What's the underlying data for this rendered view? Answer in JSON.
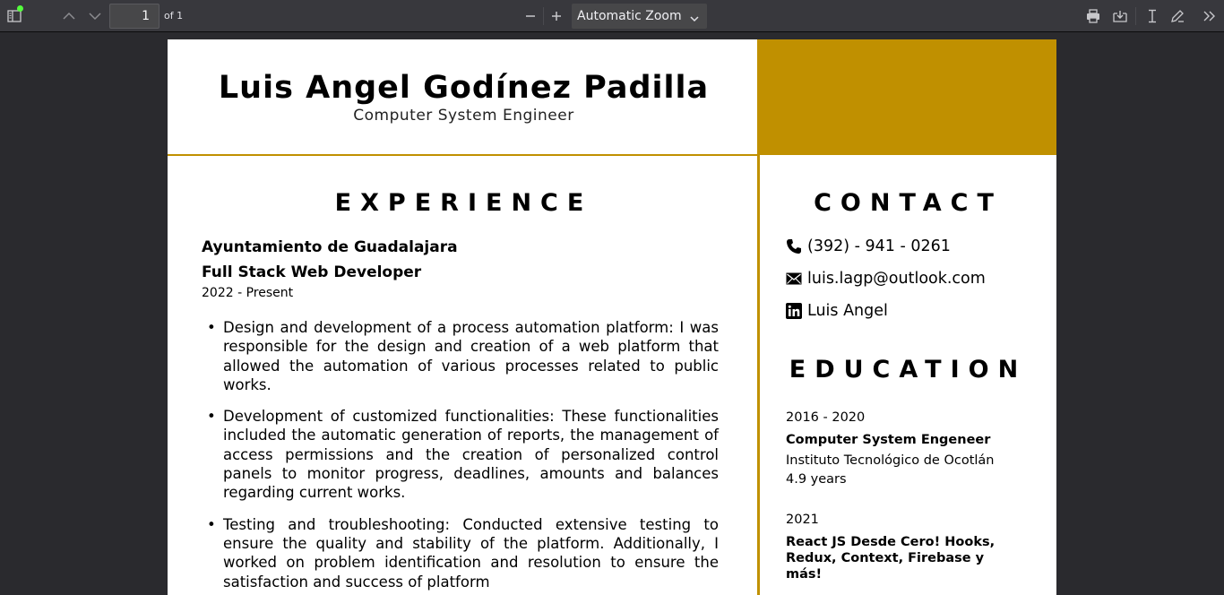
{
  "toolbar": {
    "page_number": "1",
    "page_count": "of 1",
    "zoom_label": "Automatic Zoom"
  },
  "resume": {
    "name": "Luis Angel Godínez Padilla",
    "title": "Computer System Engineer",
    "experience": {
      "heading": "EXPERIENCE",
      "company": "Ayuntamiento de Guadalajara",
      "role": "Full Stack Web Developer",
      "period": "2022 - Present",
      "bullets": [
        "Design and development of a process automation platform: I was responsible for the design and creation of a web platform that allowed the automation of various processes related to public works.",
        "Development of customized functionalities: These functionalities included the automatic generation of reports, the management of access permissions and the creation of personalized control panels to monitor progress, deadlines, amounts and balances regarding current works.",
        "Testing and troubleshooting: Conducted extensive testing to ensure the quality and stability of the platform. Additionally, I worked on problem identification and resolution to ensure the satisfaction and success of platform"
      ]
    },
    "contact": {
      "heading": "CONTACT",
      "phone": "(392) - 941 - 0261",
      "email": "luis.lagp@outlook.com",
      "linkedin": "Luis Angel"
    },
    "education": {
      "heading": "EDUCATION",
      "items": [
        {
          "years": "2016 - 2020",
          "degree": "Computer System Engeneer",
          "school": "Instituto Tecnológico de Ocotlán",
          "duration": "4.9 years"
        },
        {
          "years": "2021",
          "degree": "React JS Desde Cero! Hooks, Redux, Context, Firebase y más!"
        }
      ]
    },
    "accent_color": "#c09000"
  }
}
